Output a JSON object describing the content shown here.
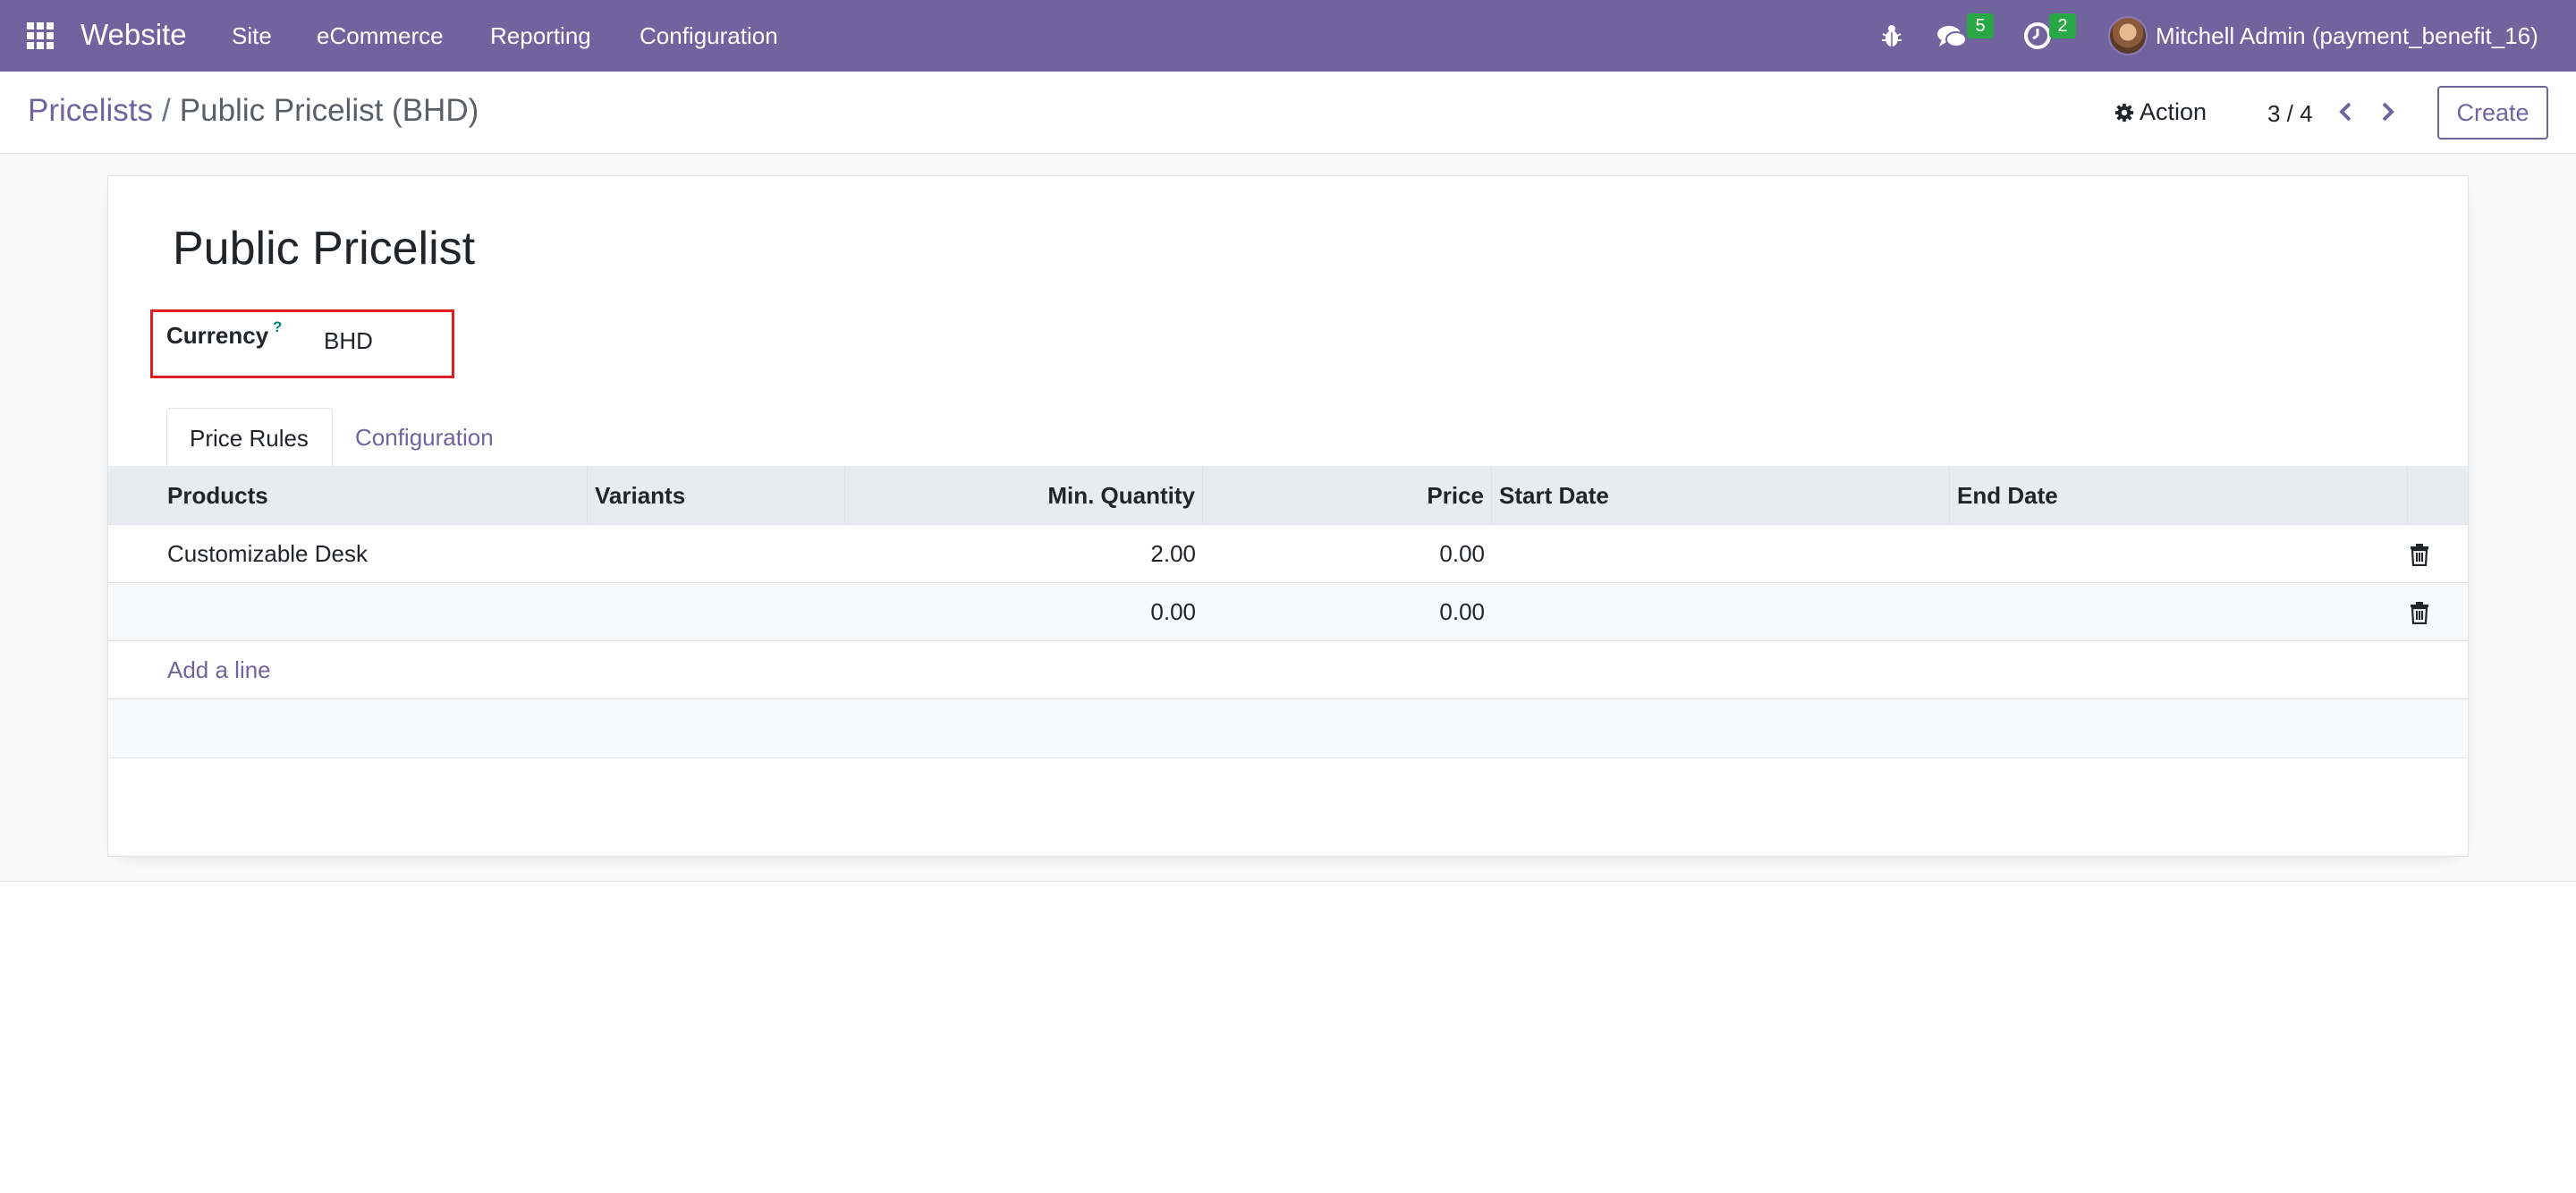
{
  "navbar": {
    "app_name": "Website",
    "menu": [
      "Site",
      "eCommerce",
      "Reporting",
      "Configuration"
    ],
    "messages_count": "5",
    "activities_count": "2",
    "user_name": "Mitchell Admin (payment_benefit_16)",
    "background_color": "#71639e"
  },
  "control_panel": {
    "breadcrumb_parent": "Pricelists",
    "breadcrumb_separator": "/",
    "breadcrumb_current": "Public Pricelist (BHD)",
    "action_label": "Action",
    "pager_value": "3 / 4",
    "create_label": "Create"
  },
  "form": {
    "title": "Public Pricelist",
    "currency_label": "Currency",
    "help_mark": "?",
    "currency_value": "BHD"
  },
  "tabs": [
    {
      "label": "Price Rules",
      "active": true
    },
    {
      "label": "Configuration",
      "active": false
    }
  ],
  "table": {
    "columns": [
      "Products",
      "Variants",
      "Min. Quantity",
      "Price",
      "Start Date",
      "End Date"
    ],
    "rows": [
      {
        "product": "Customizable Desk",
        "variants": "",
        "min_qty": "2.00",
        "price": "0.00",
        "start": "",
        "end": ""
      },
      {
        "product": "",
        "variants": "",
        "min_qty": "0.00",
        "price": "0.00",
        "start": "",
        "end": ""
      }
    ],
    "add_line_label": "Add a line"
  }
}
